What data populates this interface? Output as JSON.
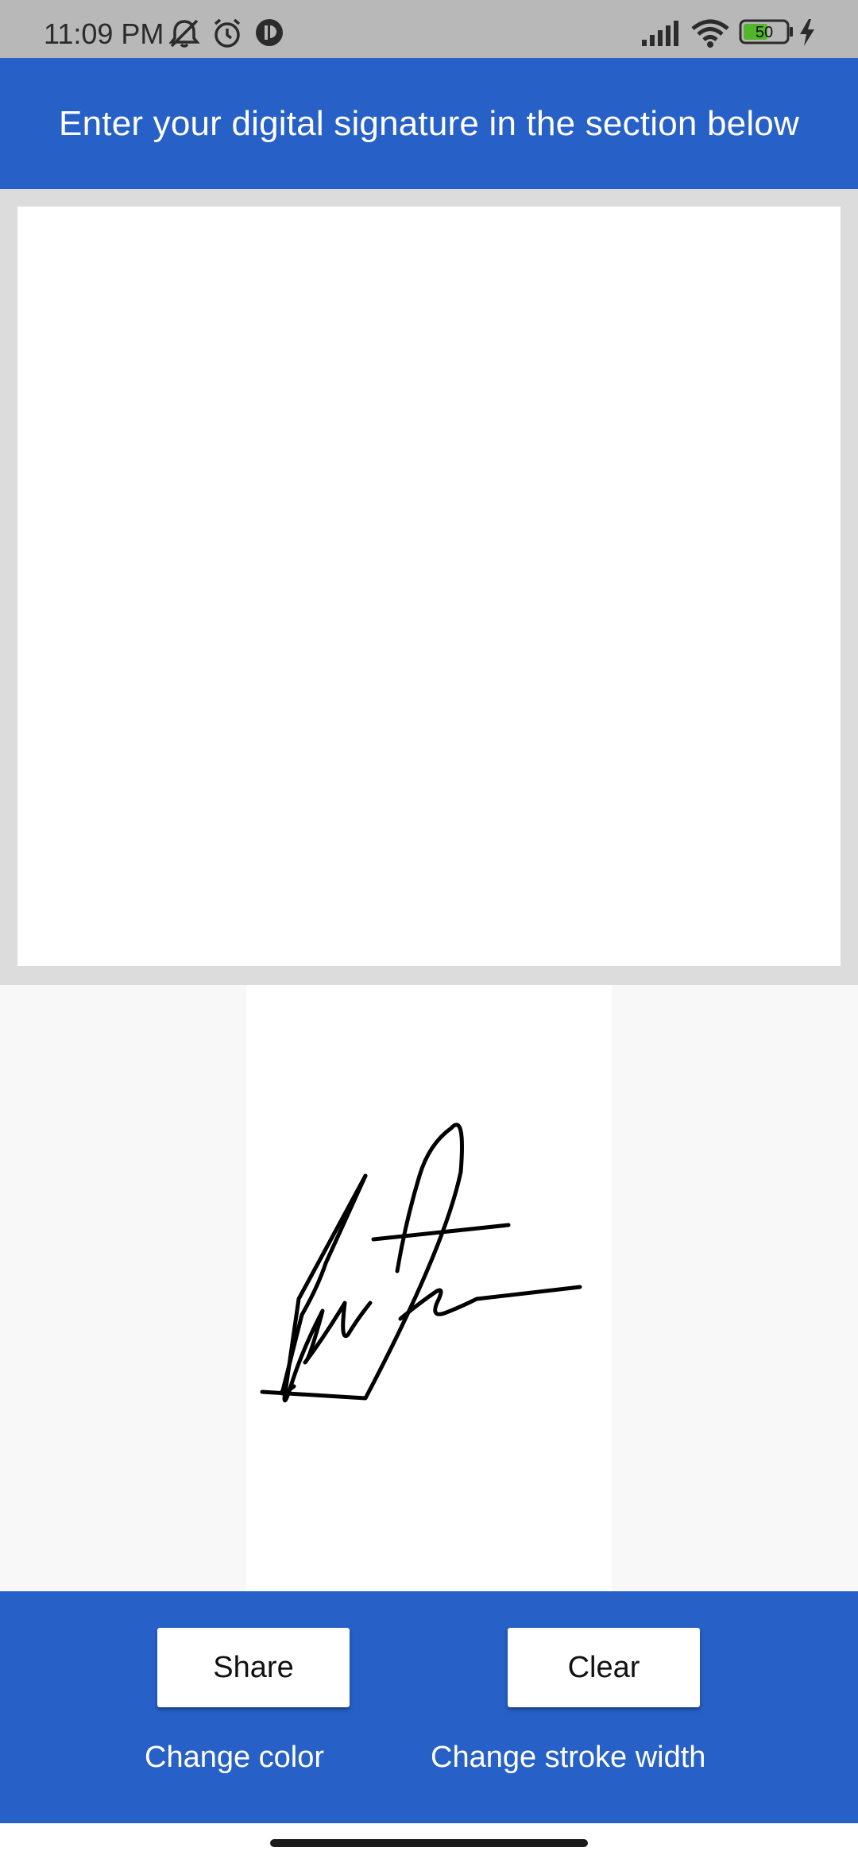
{
  "status_bar": {
    "time": "11:09 PM",
    "battery_level": "50",
    "icons": [
      "mute-icon",
      "alarm-icon",
      "app-notification-icon",
      "signal-icon",
      "wifi-icon",
      "battery-icon",
      "charging-icon"
    ]
  },
  "header": {
    "title": "Enter your digital signature in the section below",
    "background_color": "#2760c6"
  },
  "signature_pad": {
    "background_color": "#ffffff",
    "frame_color": "#dcdcdc"
  },
  "preview": {
    "background_color": "#f8f8f8",
    "stroke_color": "#000000"
  },
  "actions": {
    "share_label": "Share",
    "clear_label": "Clear",
    "change_color_label": "Change color",
    "change_stroke_width_label": "Change stroke width"
  }
}
